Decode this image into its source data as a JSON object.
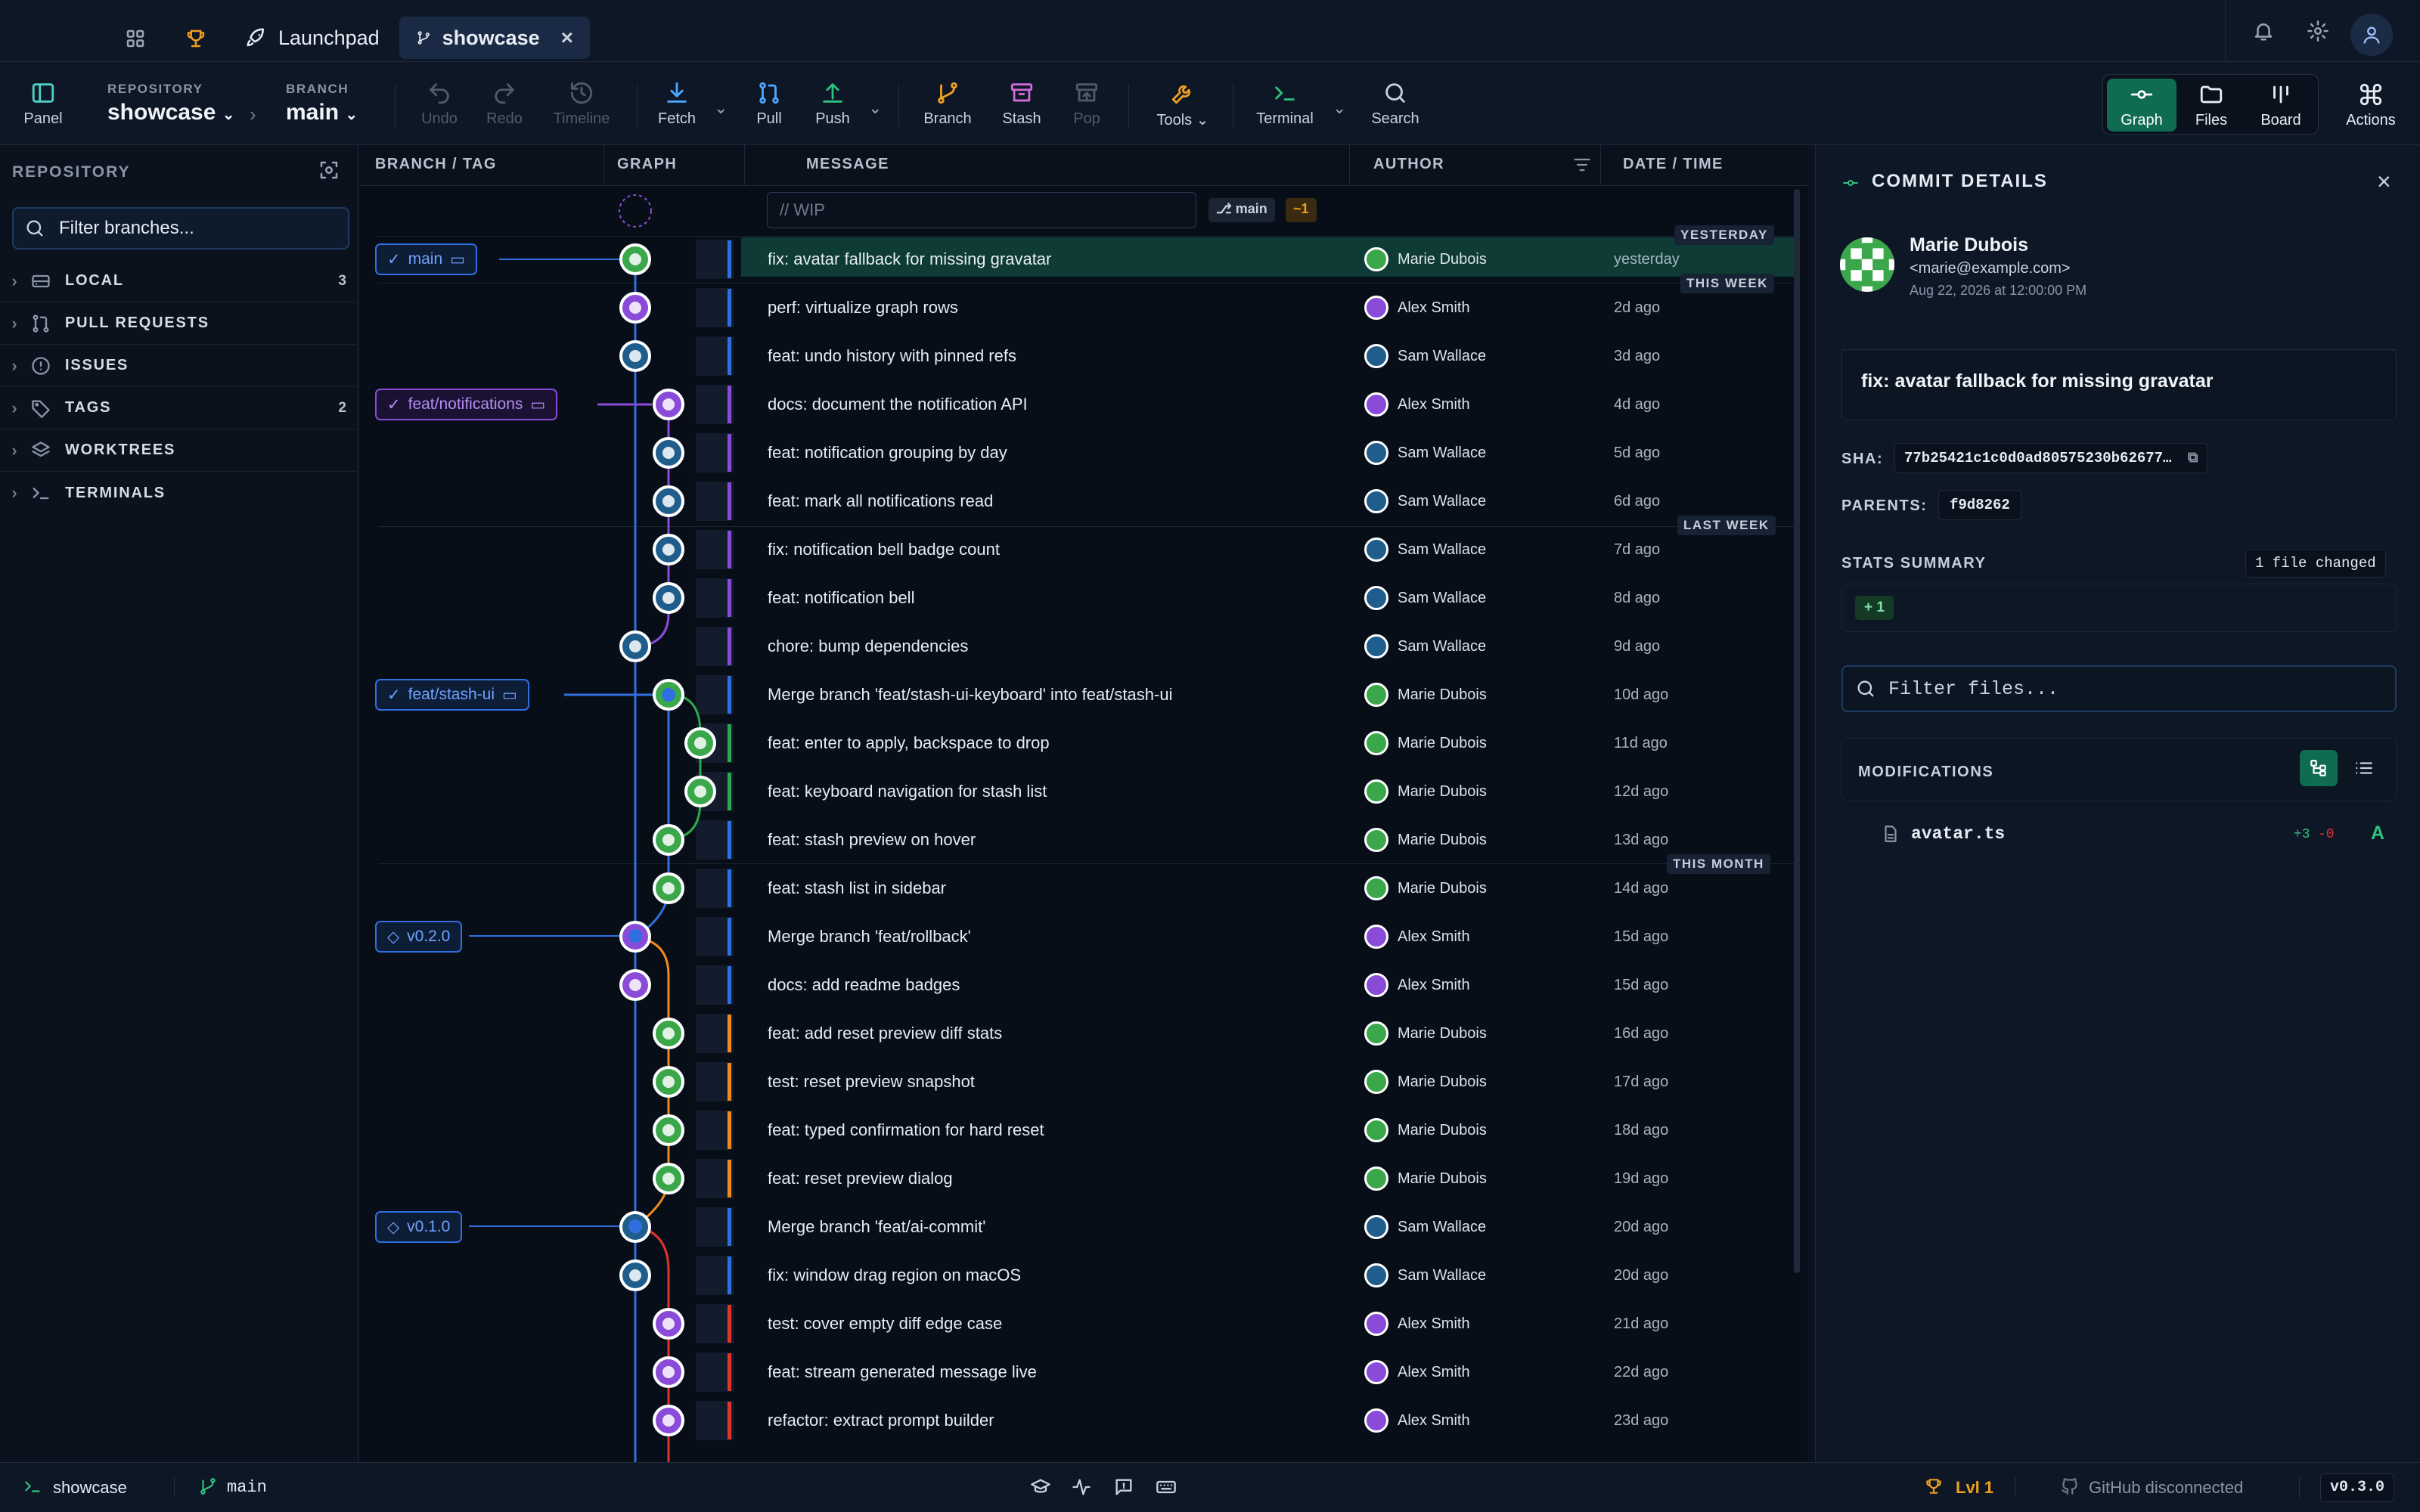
{
  "tabs": [
    {
      "label": "Launchpad",
      "icon": "rocket-icon"
    },
    {
      "label": "showcase",
      "icon": "branch-icon"
    }
  ],
  "toolbar": {
    "panel": "Panel",
    "repo_label": "REPOSITORY",
    "repo": "showcase",
    "branch_label": "BRANCH",
    "branch": "main",
    "undo": "Undo",
    "redo": "Redo",
    "timeline": "Timeline",
    "fetch": "Fetch",
    "pull": "Pull",
    "push": "Push",
    "branch_btn": "Branch",
    "stash": "Stash",
    "pop": "Pop",
    "tools": "Tools",
    "terminal": "Terminal",
    "search": "Search",
    "graph": "Graph",
    "files": "Files",
    "board": "Board",
    "actions": "Actions"
  },
  "sidebar": {
    "title": "REPOSITORY",
    "filter_placeholder": "Filter branches...",
    "items": [
      {
        "label": "LOCAL",
        "count": "3",
        "icon": "drive-icon"
      },
      {
        "label": "PULL REQUESTS",
        "count": "",
        "icon": "pull-request-icon"
      },
      {
        "label": "ISSUES",
        "count": "",
        "icon": "issue-icon"
      },
      {
        "label": "TAGS",
        "count": "2",
        "icon": "tag-icon"
      },
      {
        "label": "WORKTREES",
        "count": "",
        "icon": "layers-icon"
      },
      {
        "label": "TERMINALS",
        "count": "",
        "icon": "terminal-icon"
      }
    ]
  },
  "columns": {
    "branch": "BRANCH / TAG",
    "graph": "GRAPH",
    "message": "MESSAGE",
    "author": "AUTHOR",
    "date": "DATE / TIME"
  },
  "wip": {
    "placeholder": "// WIP",
    "branch": "main",
    "count": "~1"
  },
  "refs": {
    "main": "main",
    "feat_notifications": "feat/notifications",
    "feat_stash_ui": "feat/stash-ui",
    "v020": "v0.2.0",
    "v010": "v0.1.0"
  },
  "day_separators": {
    "yesterday": "YESTERDAY",
    "this_week": "THIS WEEK",
    "last_week": "LAST WEEK",
    "this_month": "THIS MONTH"
  },
  "commits": [
    {
      "message": "fix: avatar fallback for missing gravatar",
      "author": "Marie Dubois",
      "date": "yesterday"
    },
    {
      "message": "perf: virtualize graph rows",
      "author": "Alex Smith",
      "date": "2d ago"
    },
    {
      "message": "feat: undo history with pinned refs",
      "author": "Sam Wallace",
      "date": "3d ago"
    },
    {
      "message": "docs: document the notification API",
      "author": "Alex Smith",
      "date": "4d ago"
    },
    {
      "message": "feat: notification grouping by day",
      "author": "Sam Wallace",
      "date": "5d ago"
    },
    {
      "message": "feat: mark all notifications read",
      "author": "Sam Wallace",
      "date": "6d ago"
    },
    {
      "message": "fix: notification bell badge count",
      "author": "Sam Wallace",
      "date": "7d ago"
    },
    {
      "message": "feat: notification bell",
      "author": "Sam Wallace",
      "date": "8d ago"
    },
    {
      "message": "chore: bump dependencies",
      "author": "Sam Wallace",
      "date": "9d ago"
    },
    {
      "message": "Merge branch 'feat/stash-ui-keyboard' into feat/stash-ui",
      "author": "Marie Dubois",
      "date": "10d ago"
    },
    {
      "message": "feat: enter to apply, backspace to drop",
      "author": "Marie Dubois",
      "date": "11d ago"
    },
    {
      "message": "feat: keyboard navigation for stash list",
      "author": "Marie Dubois",
      "date": "12d ago"
    },
    {
      "message": "feat: stash preview on hover",
      "author": "Marie Dubois",
      "date": "13d ago"
    },
    {
      "message": "feat: stash list in sidebar",
      "author": "Marie Dubois",
      "date": "14d ago"
    },
    {
      "message": "Merge branch 'feat/rollback'",
      "author": "Alex Smith",
      "date": "15d ago"
    },
    {
      "message": "docs: add readme badges",
      "author": "Alex Smith",
      "date": "15d ago"
    },
    {
      "message": "feat: add reset preview diff stats",
      "author": "Marie Dubois",
      "date": "16d ago"
    },
    {
      "message": "test: reset preview snapshot",
      "author": "Marie Dubois",
      "date": "17d ago"
    },
    {
      "message": "feat: typed confirmation for hard reset",
      "author": "Marie Dubois",
      "date": "18d ago"
    },
    {
      "message": "feat: reset preview dialog",
      "author": "Marie Dubois",
      "date": "19d ago"
    },
    {
      "message": "Merge branch 'feat/ai-commit'",
      "author": "Sam Wallace",
      "date": "20d ago"
    },
    {
      "message": "fix: window drag region on macOS",
      "author": "Sam Wallace",
      "date": "20d ago"
    },
    {
      "message": "test: cover empty diff edge case",
      "author": "Alex Smith",
      "date": "21d ago"
    },
    {
      "message": "feat: stream generated message live",
      "author": "Alex Smith",
      "date": "22d ago"
    },
    {
      "message": "refactor: extract prompt builder",
      "author": "Alex Smith",
      "date": "23d ago"
    }
  ],
  "details": {
    "title": "COMMIT DETAILS",
    "author": "Marie Dubois",
    "email": "<marie@example.com>",
    "date": "Aug 22, 2026 at 12:00:00 PM",
    "message": "fix: avatar fallback for missing gravatar",
    "sha_label": "SHA:",
    "sha": "77b25421c1c0d0ad80575230b62677…",
    "parents_label": "PARENTS:",
    "parent": "f9d8262",
    "stats_label": "STATS SUMMARY",
    "files_changed": "1 file changed",
    "additions": "+ 1",
    "filter_placeholder": "Filter files...",
    "mods_label": "MODIFICATIONS",
    "file": {
      "name": "avatar.ts",
      "added": "+3",
      "removed": "-0",
      "status": "A"
    }
  },
  "status": {
    "repo": "showcase",
    "branch": "main",
    "level": "Lvl 1",
    "github": "GitHub disconnected",
    "version": "v0.3.0"
  },
  "colors": {
    "accent": "#2ec27e",
    "main": "#2f6fe0",
    "notifications": "#8a4bd8",
    "stash": "#2ea84f",
    "rollback": "#f08a1c",
    "ai": "#e0342c"
  }
}
